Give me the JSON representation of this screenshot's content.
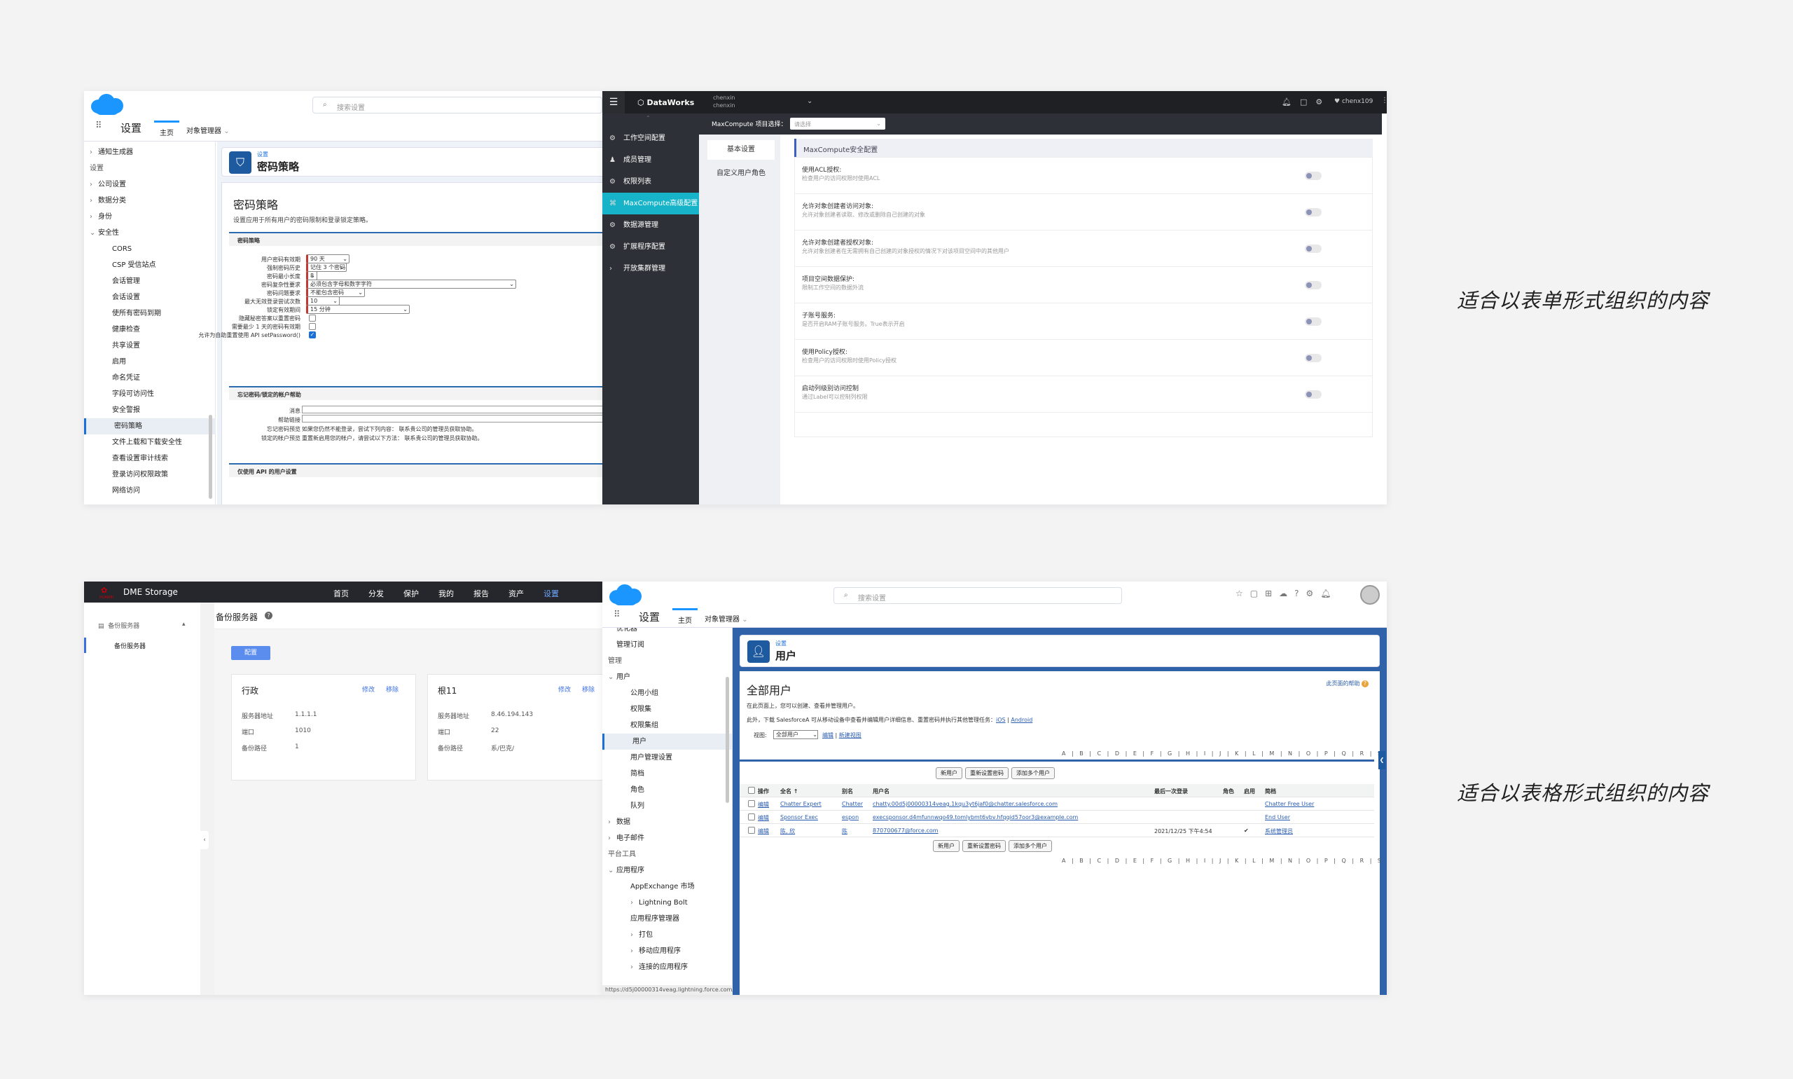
{
  "captions": {
    "form": "适合以表单形式组织的内容",
    "table": "适合以表格形式组织的内容"
  },
  "sf1": {
    "search_placeholder": "搜索设置",
    "app_name": "设置",
    "tab_home": "主页",
    "tab_objects": "对象管理器",
    "tree": [
      {
        "label": "通知生成器",
        "level": 0,
        "chev": "right"
      },
      {
        "label": "设置",
        "level": -1,
        "chev": ""
      },
      {
        "label": "公司设置",
        "level": 0,
        "chev": "right"
      },
      {
        "label": "数据分类",
        "level": 0,
        "chev": "right"
      },
      {
        "label": "身份",
        "level": 0,
        "chev": "right"
      },
      {
        "label": "安全性",
        "level": 0,
        "chev": "down"
      },
      {
        "label": "CORS",
        "level": 1,
        "chev": ""
      },
      {
        "label": "CSP 受信站点",
        "level": 1,
        "chev": ""
      },
      {
        "label": "会话管理",
        "level": 1,
        "chev": ""
      },
      {
        "label": "会话设置",
        "level": 1,
        "chev": ""
      },
      {
        "label": "使所有密码到期",
        "level": 1,
        "chev": ""
      },
      {
        "label": "健康检查",
        "level": 1,
        "chev": ""
      },
      {
        "label": "共享设置",
        "level": 1,
        "chev": ""
      },
      {
        "label": "启用",
        "level": 1,
        "chev": ""
      },
      {
        "label": "命名凭证",
        "level": 1,
        "chev": ""
      },
      {
        "label": "字段可访问性",
        "level": 1,
        "chev": ""
      },
      {
        "label": "安全警报",
        "level": 1,
        "chev": ""
      },
      {
        "label": "密码策略",
        "level": 1,
        "chev": "",
        "selected": true
      },
      {
        "label": "文件上载和下载安全性",
        "level": 1,
        "chev": ""
      },
      {
        "label": "查看设置审计线索",
        "level": 1,
        "chev": ""
      },
      {
        "label": "登录访问权限政策",
        "level": 1,
        "chev": ""
      },
      {
        "label": "网络访问",
        "level": 1,
        "chev": ""
      }
    ],
    "header_small": "设置",
    "header_title": "密码策略",
    "page_title": "密码策略",
    "page_desc": "设置应用于所有用户的密码限制和登录锁定策略。",
    "section1": "密码策略",
    "fields": [
      {
        "label": "用户密码有效期",
        "type": "select",
        "value": "90 天"
      },
      {
        "label": "强制密码历史",
        "type": "select",
        "value": "记住 3 个密码"
      },
      {
        "label": "密码最小长度",
        "type": "select",
        "value": "8"
      },
      {
        "label": "密码复杂性要求",
        "type": "select",
        "value": "必须包含字母和数字字符"
      },
      {
        "label": "密码问题要求",
        "type": "select",
        "value": "不能包含密码"
      },
      {
        "label": "最大无效登录尝试次数",
        "type": "select",
        "value": "10"
      },
      {
        "label": "锁定有效期间",
        "type": "select",
        "value": "15 分钟"
      },
      {
        "label": "隐藏秘密答案以重置密码",
        "type": "checkbox",
        "checked": false
      },
      {
        "label": "需要最少 1 天的密码有效期",
        "type": "checkbox",
        "checked": false
      },
      {
        "label": "允许为自助重置使用 API setPassword()",
        "type": "checkbox",
        "checked": true
      }
    ],
    "section2": "忘记密码/锁定的帐户帮助",
    "help_fields": [
      {
        "label": "消息",
        "value": ""
      },
      {
        "label": "帮助链接",
        "value": ""
      },
      {
        "label": "忘记密码预览",
        "value": "如果您仍然不能登录，尝试下列内容： 联系贵公司的管理员获取协助。"
      },
      {
        "label": "锁定的帐户预览",
        "value": "重置新启用您的帐户，请尝试以下方法： 联系贵公司的管理员获取协助。"
      }
    ],
    "section3": "仅使用 API 的用户设置"
  },
  "dw": {
    "brand": "DataWorks",
    "account_line1": "chenxin",
    "account_line2": "chenxin",
    "user": "chenx109",
    "project_label": "MaxCompute 项目选择：",
    "project_placeholder": "请选择",
    "side": [
      {
        "label": "工作空间配置",
        "active": false
      },
      {
        "label": "成员管理",
        "active": false
      },
      {
        "label": "权限列表",
        "active": false
      },
      {
        "label": "MaxCompute高级配置",
        "active": true
      },
      {
        "label": "数据源管理",
        "active": false
      },
      {
        "label": "扩展程序配置",
        "active": false
      },
      {
        "label": "开放集群管理",
        "active": false
      }
    ],
    "subtabs": [
      "基本设置",
      "自定义用户角色"
    ],
    "section": "MaxCompute安全配置",
    "rows": [
      {
        "title": "使用ACL授权:",
        "desc": "检查用户的访问权限时使用ACL"
      },
      {
        "title": "允许对象创建者访问对象:",
        "desc": "允许对象创建者读取、修改或删除自己创建的对象"
      },
      {
        "title": "允许对象创建者授权对象:",
        "desc": "允许对象创建者在无需拥有自己创建的对象授权的情况下对该项目空间中的其他用户"
      },
      {
        "title": "项目空间数据保护:",
        "desc": "限制工作空间的数据外流"
      },
      {
        "title": "子账号服务:",
        "desc": "是否开启RAM子账号服务。True表示开启"
      },
      {
        "title": "使用Policy授权:",
        "desc": "检查用户的访问权限时使用Policy授权"
      },
      {
        "title": "启动列级别访问控制",
        "desc": "通过Label可以控制列权限"
      }
    ]
  },
  "dme": {
    "brand": "DME Storage",
    "vendor": "HUAWEI",
    "nav": [
      "首页",
      "分发",
      "保护",
      "我的",
      "报告",
      "资产",
      "设置"
    ],
    "active_nav": "设置",
    "side_group": "备份服务器",
    "side_item": "备份服务器",
    "title": "备份服务器",
    "config_btn": "配置",
    "cards": [
      {
        "name": "行政",
        "edit": "修改",
        "del": "移除",
        "rows": [
          [
            "服务器地址",
            "1.1.1.1"
          ],
          [
            "端口",
            "1010"
          ],
          [
            "备份路径",
            "1"
          ]
        ]
      },
      {
        "name": "根11",
        "edit": "修改",
        "del": "移除",
        "rows": [
          [
            "服务器地址",
            "8.46.194.143"
          ],
          [
            "端口",
            "22"
          ],
          [
            "备份路径",
            "系/巴克/"
          ]
        ]
      }
    ]
  },
  "sf2": {
    "search_placeholder": "搜索设置",
    "app_name": "设置",
    "tab_home": "主页",
    "tab_objects": "对象管理器",
    "tree": [
      {
        "label": "优化器",
        "level": 0,
        "chev": ""
      },
      {
        "label": "管理订阅",
        "level": 0,
        "chev": ""
      },
      {
        "label": "管理",
        "level": -1,
        "chev": ""
      },
      {
        "label": "用户",
        "level": 0,
        "chev": "down"
      },
      {
        "label": "公用小组",
        "level": 1,
        "chev": ""
      },
      {
        "label": "权限集",
        "level": 1,
        "chev": ""
      },
      {
        "label": "权限集组",
        "level": 1,
        "chev": ""
      },
      {
        "label": "用户",
        "level": 1,
        "chev": "",
        "selected": true
      },
      {
        "label": "用户管理设置",
        "level": 1,
        "chev": ""
      },
      {
        "label": "简档",
        "level": 1,
        "chev": ""
      },
      {
        "label": "角色",
        "level": 1,
        "chev": ""
      },
      {
        "label": "队列",
        "level": 1,
        "chev": ""
      },
      {
        "label": "数据",
        "level": 0,
        "chev": "right"
      },
      {
        "label": "电子邮件",
        "level": 0,
        "chev": "right"
      },
      {
        "label": "平台工具",
        "level": -1,
        "chev": ""
      },
      {
        "label": "应用程序",
        "level": 0,
        "chev": "down"
      },
      {
        "label": "AppExchange 市场",
        "level": 1,
        "chev": ""
      },
      {
        "label": "Lightning Bolt",
        "level": 1,
        "chev": "right"
      },
      {
        "label": "应用程序管理器",
        "level": 1,
        "chev": ""
      },
      {
        "label": "打包",
        "level": 1,
        "chev": "right"
      },
      {
        "label": "移动应用程序",
        "level": 1,
        "chev": "right"
      },
      {
        "label": "连接的应用程序",
        "level": 1,
        "chev": "right"
      }
    ],
    "header_small": "设置",
    "header_title": "用户",
    "page_title": "全部用户",
    "help_link": "此页面的帮助",
    "desc1": "在此页面上，您可以创建、查看并管理用户。",
    "desc2_a": "此外，下载 SalesforceA 可从移动设备中查看并编辑用户详细信息、重置密码并执行其他管理任务：",
    "ios": "iOS",
    "android": "Android",
    "view_label": "视图:",
    "view_value": "全部用户",
    "view_edit": "编辑",
    "view_new": "新建视图",
    "alpha": "A | B | C | D | E | F | G | H | I | J | K | L | M | N | O | P | Q | R | S | T | U | V | W | X | Y | Z | 其他 | 全部",
    "buttons": [
      "新用户",
      "重新设置密码",
      "添加多个用户"
    ],
    "columns": [
      "操作",
      "全名 ↑",
      "别名",
      "用户名",
      "最后一次登录",
      "角色",
      "启用",
      "简档"
    ],
    "rows": [
      {
        "action": "编辑",
        "name": "Chatter Expert",
        "alias": "Chatter",
        "username": "chatty.00d5j00000314veag.1kqu3yt6jaf0@chatter.salesforce.com",
        "last": "",
        "role": "",
        "active": "",
        "profile": "Chatter Free User"
      },
      {
        "action": "编辑",
        "name": "Sponsor Exec",
        "alias": "espon",
        "username": "execsponsor.d4mfunnwqo49.tomlybmt6vbv.hfqqid57oor3@example.com",
        "last": "",
        "role": "",
        "active": "",
        "profile": "End User"
      },
      {
        "action": "编辑",
        "name": "陈, 欣",
        "alias": "陈",
        "username": "870700677@force.com",
        "last": "2021/12/25 下午4:54",
        "role": "",
        "active": "✔",
        "profile": "系统管理员"
      }
    ],
    "status_url": "https://d5j00000314veag.lightning.force.com/one/one.app#/setup/ManageUsers/home"
  }
}
